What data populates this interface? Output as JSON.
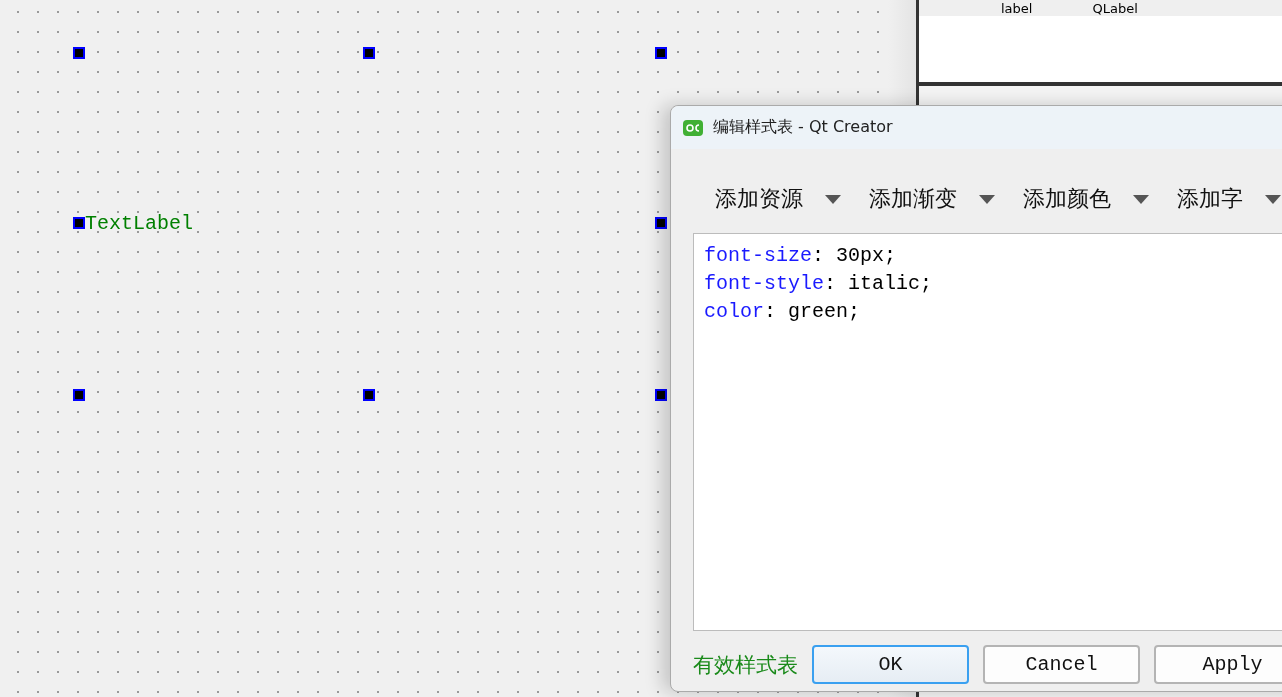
{
  "canvas": {
    "label": "TextLabel"
  },
  "property_header": {
    "columns": [
      "label",
      "QLabel"
    ]
  },
  "dialog": {
    "title": "编辑样式表 - Qt Creator",
    "toolbar": [
      {
        "label": "添加资源"
      },
      {
        "label": "添加渐变"
      },
      {
        "label": "添加颜色"
      },
      {
        "label": "添加字"
      }
    ],
    "lines": [
      {
        "property": "font-size",
        "rest": ": 30px;"
      },
      {
        "property": "font-style",
        "rest": ": italic;"
      },
      {
        "property": "color",
        "rest": ": green;"
      }
    ],
    "status": "有效样式表",
    "buttons": [
      {
        "label": "OK",
        "selected": true
      },
      {
        "label": "Cancel",
        "selected": false
      },
      {
        "label": "Apply",
        "selected": false
      }
    ]
  }
}
